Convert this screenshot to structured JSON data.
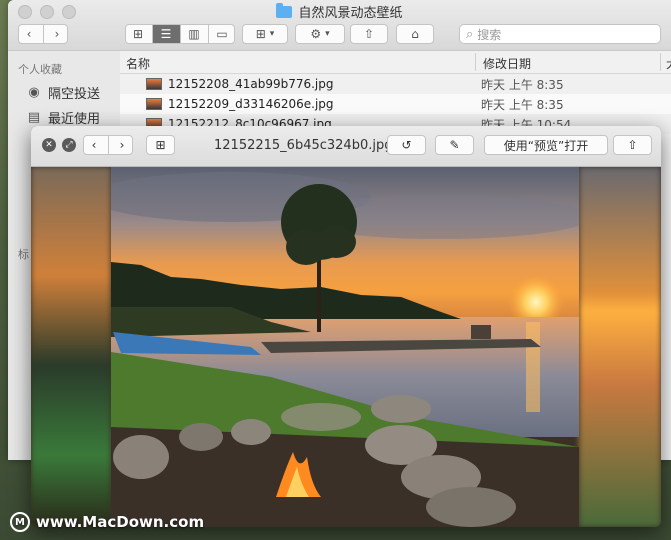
{
  "finder": {
    "title": "自然风景动态壁纸",
    "search_placeholder": "搜索",
    "sidebar": {
      "favorites_heading": "个人收藏",
      "items": [
        {
          "label": "隔空投送",
          "icon": "airdrop-icon"
        },
        {
          "label": "最近使用",
          "icon": "recents-icon"
        }
      ],
      "tags_heading": "标"
    },
    "columns": {
      "name": "名称",
      "date": "修改日期",
      "size": "大"
    },
    "files": [
      {
        "name": "12152208_41ab99b776.jpg",
        "date": "昨天 上午 8:35"
      },
      {
        "name": "12152209_d33146206e.jpg",
        "date": "昨天 上午 8:35"
      },
      {
        "name": "12152212_8c10c96967.jpg",
        "date": "昨天 上午 10:54"
      }
    ]
  },
  "quicklook": {
    "filename": "12152215_6b45c324b0.jpg",
    "open_with_label": "使用“预览”打开"
  },
  "watermark": {
    "text": "www.MacDown.com",
    "logo_letter": "M"
  }
}
